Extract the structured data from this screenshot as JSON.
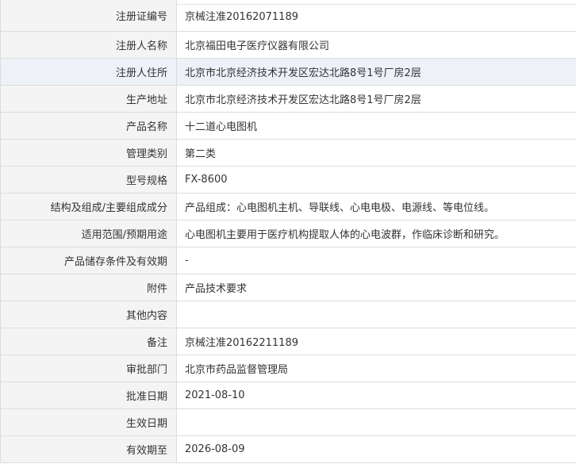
{
  "rows": [
    {
      "label": "注册证编号",
      "value": "京械注准20162071189"
    },
    {
      "label": "注册人名称",
      "value": "北京福田电子医疗仪器有限公司"
    },
    {
      "label": "注册人住所",
      "value": "北京市北京经济技术开发区宏达北路8号1号厂房2层"
    },
    {
      "label": "生产地址",
      "value": "北京市北京经济技术开发区宏达北路8号1号厂房2层"
    },
    {
      "label": "产品名称",
      "value": "十二道心电图机"
    },
    {
      "label": "管理类别",
      "value": "第二类"
    },
    {
      "label": "型号规格",
      "value": "FX-8600"
    },
    {
      "label": "结构及组成/主要组成成分",
      "value": "产品组成：心电图机主机、导联线、心电电极、电源线、等电位线。"
    },
    {
      "label": "适用范围/预期用途",
      "value": "心电图机主要用于医疗机构提取人体的心电波群，作临床诊断和研究。"
    },
    {
      "label": "产品储存条件及有效期",
      "value": "-"
    },
    {
      "label": "附件",
      "value": "产品技术要求"
    },
    {
      "label": "其他内容",
      "value": ""
    },
    {
      "label": "备注",
      "value": "京械注准20162211189"
    },
    {
      "label": "审批部门",
      "value": "北京市药品监督管理局"
    },
    {
      "label": "批准日期",
      "value": "2021-08-10"
    },
    {
      "label": "生效日期",
      "value": ""
    },
    {
      "label": "有效期至",
      "value": "2026-08-09"
    }
  ]
}
